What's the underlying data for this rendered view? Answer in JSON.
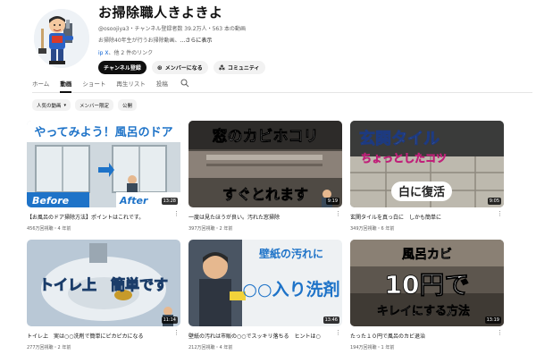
{
  "channel": {
    "name": "お掃除職人きよきよ",
    "meta": "@osoojiya3・チャンネル登録者数 39.2万人・563 本の動画",
    "description": "お掃除40年生が行うお掃除動画、",
    "more_label": "...さらに表示",
    "link_host": "ip X",
    "link_more": "、他 2 件のリンク",
    "subscribe_label": "チャンネル登録",
    "membership_label": "メンバーになる",
    "community_label": "コミュニティ"
  },
  "tabs": [
    {
      "label": "ホーム",
      "active": false
    },
    {
      "label": "動画",
      "active": true
    },
    {
      "label": "ショート",
      "active": false
    },
    {
      "label": "再生リスト",
      "active": false
    },
    {
      "label": "投稿",
      "active": false
    }
  ],
  "chips": [
    {
      "label": "人気の動画",
      "dropdown": true
    },
    {
      "label": "メンバー限定",
      "dropdown": false
    },
    {
      "label": "公開",
      "dropdown": false
    }
  ],
  "videos": [
    {
      "thumb_top": "やってみよう！風呂のドア",
      "thumb_bottom_left": "Before",
      "thumb_bottom_right": "After",
      "duration": "13:28",
      "title": "【お風呂のドア掃除方法】ポイントはこれです。",
      "meta": "456万回視聴・4 年前"
    },
    {
      "thumb_top": "窓のカビホコリ",
      "thumb_bottom": "すぐとれます",
      "duration": "9:19",
      "title": "一度は見たほうが良い。汚れた窓掃除",
      "meta": "397万回視聴・2 年前"
    },
    {
      "thumb_top": "玄関タイル",
      "thumb_middle": "ちょっとしたコツ",
      "thumb_bottom": "白に復活",
      "duration": "9:05",
      "title": "玄関タイルを真っ白に　しかも簡単に",
      "meta": "349万回視聴・6 年前"
    },
    {
      "thumb_top": "トイレ上　簡単です",
      "duration": "11:14",
      "title": "トイレ上　実は○○洗剤で簡単にピカピカになる",
      "meta": "277万回視聴・2 年前"
    },
    {
      "thumb_top": "壁紙の汚れに",
      "thumb_bottom": "○○入り洗剤",
      "duration": "13:46",
      "title": "壁紙の汚れは市販の○○でスッキリ落ちる　ヒントは○",
      "meta": "212万回視聴・4 年前"
    },
    {
      "thumb_top": "風呂カビ",
      "thumb_middle": "10円で",
      "thumb_bottom": "キレイにする方法",
      "duration": "13:19",
      "title": "たった１０円で風呂のカビ退治",
      "meta": "194万回視聴・1 年前"
    }
  ]
}
